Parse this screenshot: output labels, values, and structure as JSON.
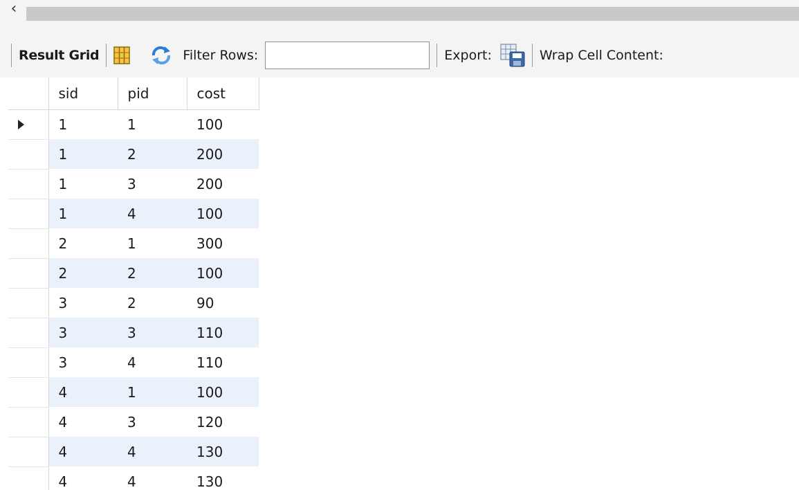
{
  "scroll": {
    "left_arrow_glyph": "‹"
  },
  "toolbar": {
    "result_grid_label": "Result Grid",
    "filter_rows_label": "Filter Rows:",
    "filter_value": "",
    "export_label": "Export:",
    "wrap_cell_label": "Wrap Cell Content:"
  },
  "grid": {
    "columns": [
      "sid",
      "pid",
      "cost"
    ],
    "rows": [
      [
        "1",
        "1",
        "100"
      ],
      [
        "1",
        "2",
        "200"
      ],
      [
        "1",
        "3",
        "200"
      ],
      [
        "1",
        "4",
        "100"
      ],
      [
        "2",
        "1",
        "300"
      ],
      [
        "2",
        "2",
        "100"
      ],
      [
        "3",
        "2",
        "90"
      ],
      [
        "3",
        "3",
        "110"
      ],
      [
        "3",
        "4",
        "110"
      ],
      [
        "4",
        "1",
        "100"
      ],
      [
        "4",
        "3",
        "120"
      ],
      [
        "4",
        "4",
        "130"
      ],
      [
        "4",
        "4",
        "130"
      ]
    ],
    "selected_row": 0
  },
  "colors": {
    "alt_row": "#eaf1fb",
    "grid_icon_fill": "#f5c542",
    "refresh_icon": "#2a7fd4",
    "export_icon": "#3a6aa8"
  }
}
